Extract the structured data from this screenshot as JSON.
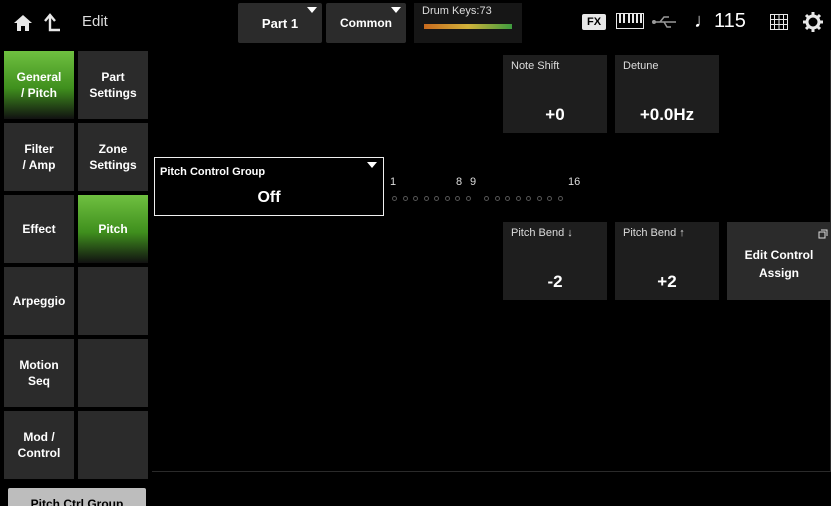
{
  "topbar": {
    "edit_label": "Edit",
    "part_label": "Part 1",
    "common_label": "Common",
    "drum_keys_label": "Drum Keys:73",
    "fx_badge": "FX",
    "tempo": "♩115",
    "icons": [
      "home-icon",
      "up-arrow-icon",
      "keyboard-icon",
      "usb-icon",
      "grid-icon",
      "gear-icon"
    ]
  },
  "tabs_level1": [
    {
      "label": "General\n/ Pitch",
      "active": true
    },
    {
      "label": "Filter\n/ Amp",
      "active": false
    },
    {
      "label": "Effect",
      "active": false
    },
    {
      "label": "Arpeggio",
      "active": false
    },
    {
      "label": "Motion\nSeq",
      "active": false
    },
    {
      "label": "Mod /\nControl",
      "active": false
    }
  ],
  "tabs_level2": [
    {
      "label": "Part\nSettings",
      "active": false
    },
    {
      "label": "Zone\nSettings",
      "active": false
    },
    {
      "label": "Pitch",
      "active": true
    }
  ],
  "params": {
    "note_shift": {
      "label": "Note Shift",
      "value": "+0"
    },
    "detune": {
      "label": "Detune",
      "value": "+0.0Hz"
    },
    "pitch_control_group": {
      "label": "Pitch Control Group",
      "value": "Off"
    },
    "pitch_bend_down": {
      "label": "Pitch Bend ↓",
      "value": "-2"
    },
    "pitch_bend_up": {
      "label": "Pitch Bend ↑",
      "value": "+2"
    }
  },
  "part_indicator": {
    "labels": [
      "1",
      "8",
      "9",
      "16"
    ],
    "count": 16
  },
  "edit_control_assign": "Edit Control\nAssign",
  "bottom_tab": "Pitch Ctrl Group",
  "colors": {
    "active_tab": "#5aad2e",
    "button_bg": "#2b2b2b",
    "background": "#000000"
  }
}
